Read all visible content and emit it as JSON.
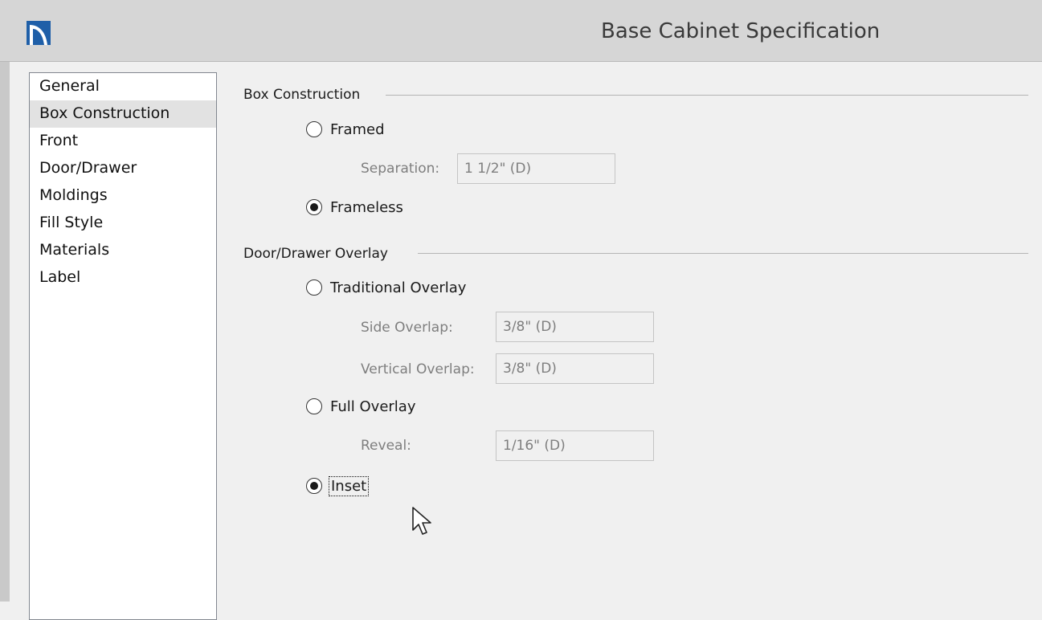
{
  "window": {
    "title": "Base Cabinet Specification",
    "app_icon": "chief-architect-app-icon"
  },
  "sidebar": {
    "items": [
      {
        "label": "General",
        "selected": false
      },
      {
        "label": "Box Construction",
        "selected": true
      },
      {
        "label": "Front",
        "selected": false
      },
      {
        "label": "Door/Drawer",
        "selected": false
      },
      {
        "label": "Moldings",
        "selected": false
      },
      {
        "label": "Fill Style",
        "selected": false
      },
      {
        "label": "Materials",
        "selected": false
      },
      {
        "label": "Label",
        "selected": false
      }
    ]
  },
  "box_construction": {
    "section_label": "Box Construction",
    "framed": {
      "label": "Framed",
      "checked": false
    },
    "separation": {
      "label": "Separation:",
      "value": "1 1/2\" (D)",
      "enabled": false
    },
    "frameless": {
      "label": "Frameless",
      "checked": true
    }
  },
  "overlay": {
    "section_label": "Door/Drawer Overlay",
    "traditional": {
      "label": "Traditional Overlay",
      "checked": false
    },
    "side_overlap": {
      "label": "Side Overlap:",
      "value": "3/8\" (D)",
      "enabled": false
    },
    "vertical_overlap": {
      "label": "Vertical Overlap:",
      "value": "3/8\" (D)",
      "enabled": false
    },
    "full": {
      "label": "Full Overlay",
      "checked": false
    },
    "reveal": {
      "label": "Reveal:",
      "value": "1/16\" (D)",
      "enabled": false
    },
    "inset": {
      "label": "Inset",
      "checked": true,
      "focused": true
    }
  },
  "cursor": {
    "icon": "mouse-pointer-icon"
  },
  "colors": {
    "background": "#f0f0f0",
    "titlebar": "#d6d6d6",
    "selected_item": "#e2e2e2",
    "disabled_text": "#7e7e7e"
  }
}
